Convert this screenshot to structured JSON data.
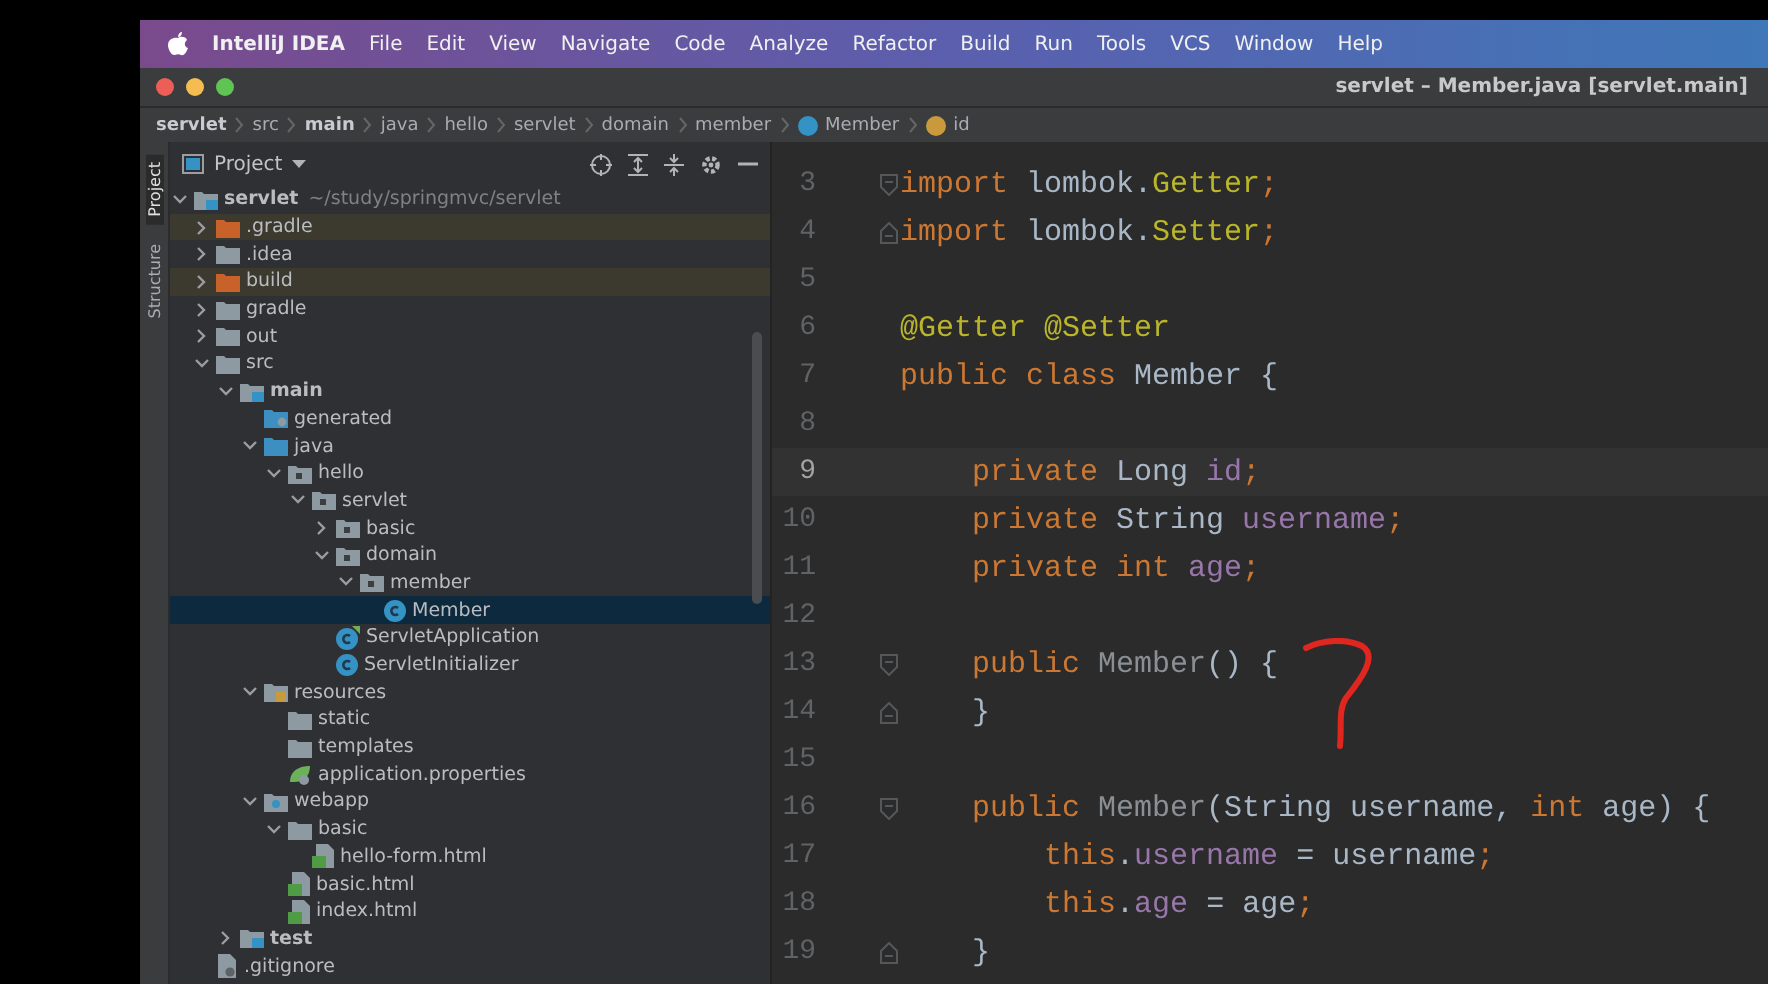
{
  "menu_bar": {
    "app_name": "IntelliJ IDEA",
    "items": [
      "File",
      "Edit",
      "View",
      "Navigate",
      "Code",
      "Analyze",
      "Refactor",
      "Build",
      "Run",
      "Tools",
      "VCS",
      "Window",
      "Help"
    ]
  },
  "window": {
    "title": "servlet – Member.java [servlet.main]"
  },
  "breadcrumbs": [
    {
      "label": "servlet",
      "kind": "module"
    },
    {
      "label": "src",
      "kind": "folder"
    },
    {
      "label": "main",
      "kind": "module"
    },
    {
      "label": "java",
      "kind": "folder"
    },
    {
      "label": "hello",
      "kind": "folder"
    },
    {
      "label": "servlet",
      "kind": "folder"
    },
    {
      "label": "domain",
      "kind": "folder"
    },
    {
      "label": "member",
      "kind": "folder"
    },
    {
      "label": "Member",
      "kind": "class"
    },
    {
      "label": "id",
      "kind": "field"
    }
  ],
  "tool_strip": [
    {
      "label": "Project",
      "selected": true
    },
    {
      "label": "Structure",
      "selected": false
    }
  ],
  "project_panel": {
    "title": "Project",
    "tree": [
      {
        "name": "servlet",
        "hint": "~/study/springmvc/servlet",
        "kind": "module",
        "expanded": true,
        "selected": false,
        "children": [
          {
            "name": ".gradle",
            "kind": "excluded-folder",
            "expanded": false,
            "selected": false
          },
          {
            "name": ".idea",
            "kind": "folder",
            "expanded": false,
            "selected": false
          },
          {
            "name": "build",
            "kind": "excluded-folder",
            "expanded": false,
            "selected": false
          },
          {
            "name": "gradle",
            "kind": "folder",
            "expanded": false,
            "selected": false
          },
          {
            "name": "out",
            "kind": "folder",
            "expanded": false,
            "selected": false
          },
          {
            "name": "src",
            "kind": "folder",
            "expanded": true,
            "selected": false,
            "children": [
              {
                "name": "main",
                "kind": "module",
                "expanded": true,
                "selected": false,
                "children": [
                  {
                    "name": "generated",
                    "kind": "generated-folder",
                    "selected": false
                  },
                  {
                    "name": "java",
                    "kind": "source-folder",
                    "expanded": true,
                    "selected": false,
                    "children": [
                      {
                        "name": "hello",
                        "kind": "package",
                        "expanded": true,
                        "selected": false,
                        "children": [
                          {
                            "name": "servlet",
                            "kind": "package",
                            "expanded": true,
                            "selected": false,
                            "children": [
                              {
                                "name": "basic",
                                "kind": "package",
                                "expanded": false,
                                "selected": false
                              },
                              {
                                "name": "domain",
                                "kind": "package",
                                "expanded": true,
                                "selected": false,
                                "children": [
                                  {
                                    "name": "member",
                                    "kind": "package",
                                    "expanded": true,
                                    "selected": false,
                                    "children": [
                                      {
                                        "name": "Member",
                                        "kind": "class",
                                        "selected": true
                                      }
                                    ]
                                  }
                                ]
                              },
                              {
                                "name": "ServletApplication",
                                "kind": "spring-class",
                                "selected": false
                              },
                              {
                                "name": "ServletInitializer",
                                "kind": "class",
                                "selected": false
                              }
                            ]
                          }
                        ]
                      }
                    ]
                  },
                  {
                    "name": "resources",
                    "kind": "resources-folder",
                    "expanded": true,
                    "selected": false,
                    "children": [
                      {
                        "name": "static",
                        "kind": "folder",
                        "selected": false
                      },
                      {
                        "name": "templates",
                        "kind": "folder",
                        "selected": false
                      },
                      {
                        "name": "application.properties",
                        "kind": "properties",
                        "selected": false
                      }
                    ]
                  },
                  {
                    "name": "webapp",
                    "kind": "web-folder",
                    "expanded": true,
                    "selected": false,
                    "children": [
                      {
                        "name": "basic",
                        "kind": "folder",
                        "expanded": true,
                        "selected": false,
                        "children": [
                          {
                            "name": "hello-form.html",
                            "kind": "html",
                            "selected": false
                          }
                        ]
                      },
                      {
                        "name": "basic.html",
                        "kind": "html",
                        "selected": false
                      },
                      {
                        "name": "index.html",
                        "kind": "html",
                        "selected": false
                      }
                    ]
                  }
                ]
              },
              {
                "name": "test",
                "kind": "module",
                "expanded": false,
                "selected": false
              }
            ]
          },
          {
            "name": ".gitignore",
            "kind": "ignore-file",
            "selected": false
          }
        ]
      }
    ]
  },
  "editor": {
    "lines": [
      {
        "number": "3",
        "kind": "fold-start",
        "current": false,
        "tokens": [
          {
            "text": "import",
            "kind": "keyword"
          },
          {
            "text": " lombok.",
            "kind": "plain"
          },
          {
            "text": "Getter",
            "kind": "annotation"
          },
          {
            "text": ";",
            "kind": "keyword"
          }
        ]
      },
      {
        "number": "4",
        "kind": "fold-end",
        "current": false,
        "tokens": [
          {
            "text": "import",
            "kind": "keyword"
          },
          {
            "text": " lombok.",
            "kind": "plain"
          },
          {
            "text": "Setter",
            "kind": "annotation"
          },
          {
            "text": ";",
            "kind": "keyword"
          }
        ]
      },
      {
        "number": "5",
        "current": false
      },
      {
        "number": "6",
        "current": false,
        "tokens": [
          {
            "text": "@Getter @Setter",
            "kind": "annotation"
          }
        ]
      },
      {
        "number": "7",
        "current": false,
        "tokens": [
          {
            "text": "public class ",
            "kind": "keyword"
          },
          {
            "text": "Member {",
            "kind": "plain"
          }
        ]
      },
      {
        "number": "8",
        "current": false
      },
      {
        "number": "9",
        "current": true,
        "tokens": [
          {
            "text": "    private ",
            "kind": "keyword"
          },
          {
            "text": "Long ",
            "kind": "plain"
          },
          {
            "text": "id",
            "kind": "field"
          },
          {
            "text": ";",
            "kind": "keyword"
          }
        ]
      },
      {
        "number": "10",
        "current": false,
        "tokens": [
          {
            "text": "    private ",
            "kind": "keyword"
          },
          {
            "text": "String ",
            "kind": "plain"
          },
          {
            "text": "username",
            "kind": "field"
          },
          {
            "text": ";",
            "kind": "keyword"
          }
        ]
      },
      {
        "number": "11",
        "current": false,
        "tokens": [
          {
            "text": "    private int ",
            "kind": "keyword"
          },
          {
            "text": "age",
            "kind": "field"
          },
          {
            "text": ";",
            "kind": "keyword"
          }
        ]
      },
      {
        "number": "12",
        "current": false
      },
      {
        "number": "13",
        "kind": "fold-start",
        "current": false,
        "tokens": [
          {
            "text": "    public ",
            "kind": "keyword"
          },
          {
            "text": "Member",
            "kind": "dim"
          },
          {
            "text": "() {",
            "kind": "plain"
          }
        ]
      },
      {
        "number": "14",
        "kind": "fold-end",
        "current": false,
        "tokens": [
          {
            "text": "    }",
            "kind": "plain"
          }
        ]
      },
      {
        "number": "15",
        "current": false
      },
      {
        "number": "16",
        "kind": "fold-start",
        "current": false,
        "tokens": [
          {
            "text": "    public ",
            "kind": "keyword"
          },
          {
            "text": "Member",
            "kind": "dim"
          },
          {
            "text": "(String username, ",
            "kind": "plain"
          },
          {
            "text": "int",
            "kind": "keyword"
          },
          {
            "text": " age) {",
            "kind": "plain"
          }
        ]
      },
      {
        "number": "17",
        "current": false,
        "tokens": [
          {
            "text": "        this",
            "kind": "keyword"
          },
          {
            "text": ".",
            "kind": "plain"
          },
          {
            "text": "username",
            "kind": "field"
          },
          {
            "text": " = username",
            "kind": "plain"
          },
          {
            "text": ";",
            "kind": "keyword"
          }
        ]
      },
      {
        "number": "18",
        "current": false,
        "tokens": [
          {
            "text": "        this",
            "kind": "keyword"
          },
          {
            "text": ".",
            "kind": "plain"
          },
          {
            "text": "age",
            "kind": "field"
          },
          {
            "text": " = age",
            "kind": "plain"
          },
          {
            "text": ";",
            "kind": "keyword"
          }
        ]
      },
      {
        "number": "19",
        "kind": "fold-end",
        "current": false,
        "tokens": [
          {
            "text": "    }",
            "kind": "plain"
          }
        ]
      }
    ]
  }
}
